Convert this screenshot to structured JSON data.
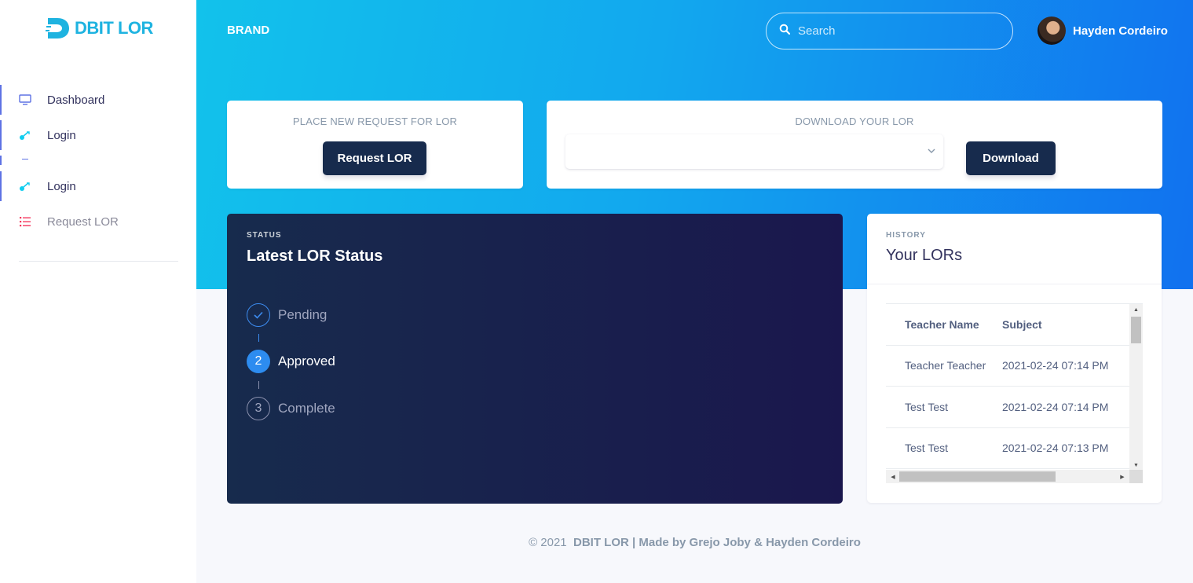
{
  "sidebar": {
    "logo_text": "DBIT LOR",
    "items": [
      {
        "label": "Dashboard",
        "icon": "monitor-icon"
      },
      {
        "label": "Login",
        "icon": "key-icon"
      },
      {
        "label": "Login",
        "icon": "key-icon"
      },
      {
        "label": "Request LOR",
        "icon": "list-icon"
      }
    ]
  },
  "header": {
    "brand": "BRAND",
    "search_placeholder": "Search",
    "user_name": "Hayden Cordeiro"
  },
  "request_card": {
    "title": "PLACE NEW REQUEST FOR LOR",
    "button": "Request LOR"
  },
  "download_card": {
    "title": "DOWNLOAD YOUR LOR",
    "select_value": "",
    "button": "Download"
  },
  "status_card": {
    "eyebrow": "STATUS",
    "title": "Latest LOR Status",
    "steps": [
      {
        "marker": "✓",
        "label": "Pending",
        "state": "done"
      },
      {
        "marker": "2",
        "label": "Approved",
        "state": "current"
      },
      {
        "marker": "3",
        "label": "Complete",
        "state": "upcoming"
      }
    ]
  },
  "history_card": {
    "eyebrow": "HISTORY",
    "title": "Your LORs",
    "columns": [
      "Teacher Name",
      "Subject"
    ],
    "rows": [
      [
        "Teacher Teacher",
        "2021-02-24 07:14 PM"
      ],
      [
        "Test Test",
        "2021-02-24 07:14 PM"
      ],
      [
        "Test Test",
        "2021-02-24 07:13 PM"
      ]
    ]
  },
  "footer": {
    "copy": "© 2021",
    "brand": "DBIT LOR",
    "made_by": "| Made by Grejo Joby & Hayden Cordeiro"
  },
  "colors": {
    "accent": "#5e72e4",
    "gradient_start": "#12c2eb",
    "gradient_end": "#1171ef",
    "dark_button": "#172b4d",
    "status_bg": "#172b4d",
    "step_active": "#2d8cf0"
  }
}
